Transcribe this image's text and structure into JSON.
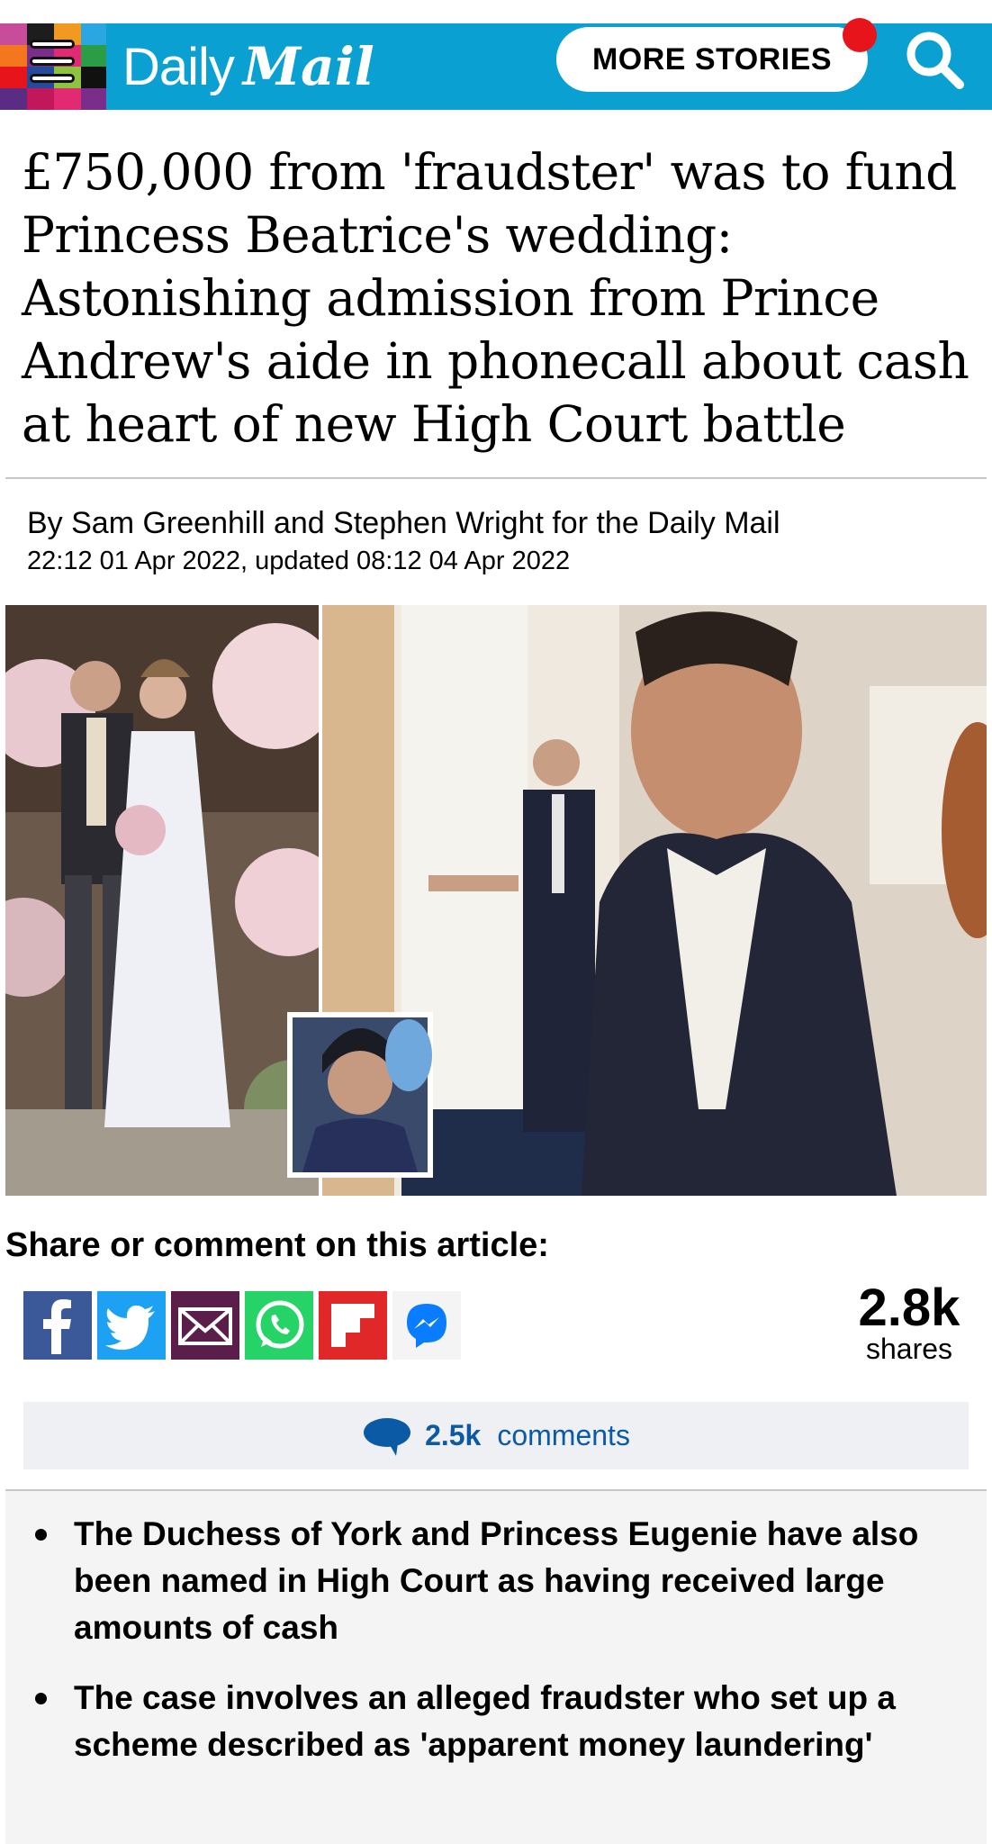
{
  "header": {
    "brand_daily": "Daily",
    "brand_mail": "Mail",
    "more_stories_label": "MORE STORIES",
    "menu_icon": "hamburger-menu-icon",
    "search_icon": "search-icon",
    "brand_color": "#0aa1d2",
    "notification_color": "#e8141b"
  },
  "article": {
    "headline": "£750,000 from 'fraudster' was to fund Princess Beatrice's wedding: Astonishing admission from Prince Andrew's aide in phonecall about cash at heart of new High Court battle",
    "byline": "By Sam Greenhill and Stephen Wright for the Daily Mail",
    "dateline": "22:12 01 Apr 2022, updated 08:12 04 Apr 2022"
  },
  "share": {
    "heading": "Share or comment on this article:",
    "buttons": [
      {
        "icon": "facebook-icon",
        "color": "#3b5998"
      },
      {
        "icon": "twitter-icon",
        "color": "#1da1f2"
      },
      {
        "icon": "email-icon",
        "color": "#5b1e4a"
      },
      {
        "icon": "whatsapp-icon",
        "color": "#25d366"
      },
      {
        "icon": "flipboard-icon",
        "color": "#e12828"
      },
      {
        "icon": "messenger-icon",
        "color": "#0a7cff"
      }
    ],
    "count": "2.8k",
    "count_label": "shares"
  },
  "comments": {
    "count": "2.5k",
    "label": "comments",
    "icon": "comment-bubble-icon"
  },
  "bullets": [
    "The Duchess of York and Princess Eugenie have also been named in High Court as having received large amounts of cash",
    "The case involves an alleged fraudster who set up a scheme described as 'apparent money laundering'"
  ]
}
